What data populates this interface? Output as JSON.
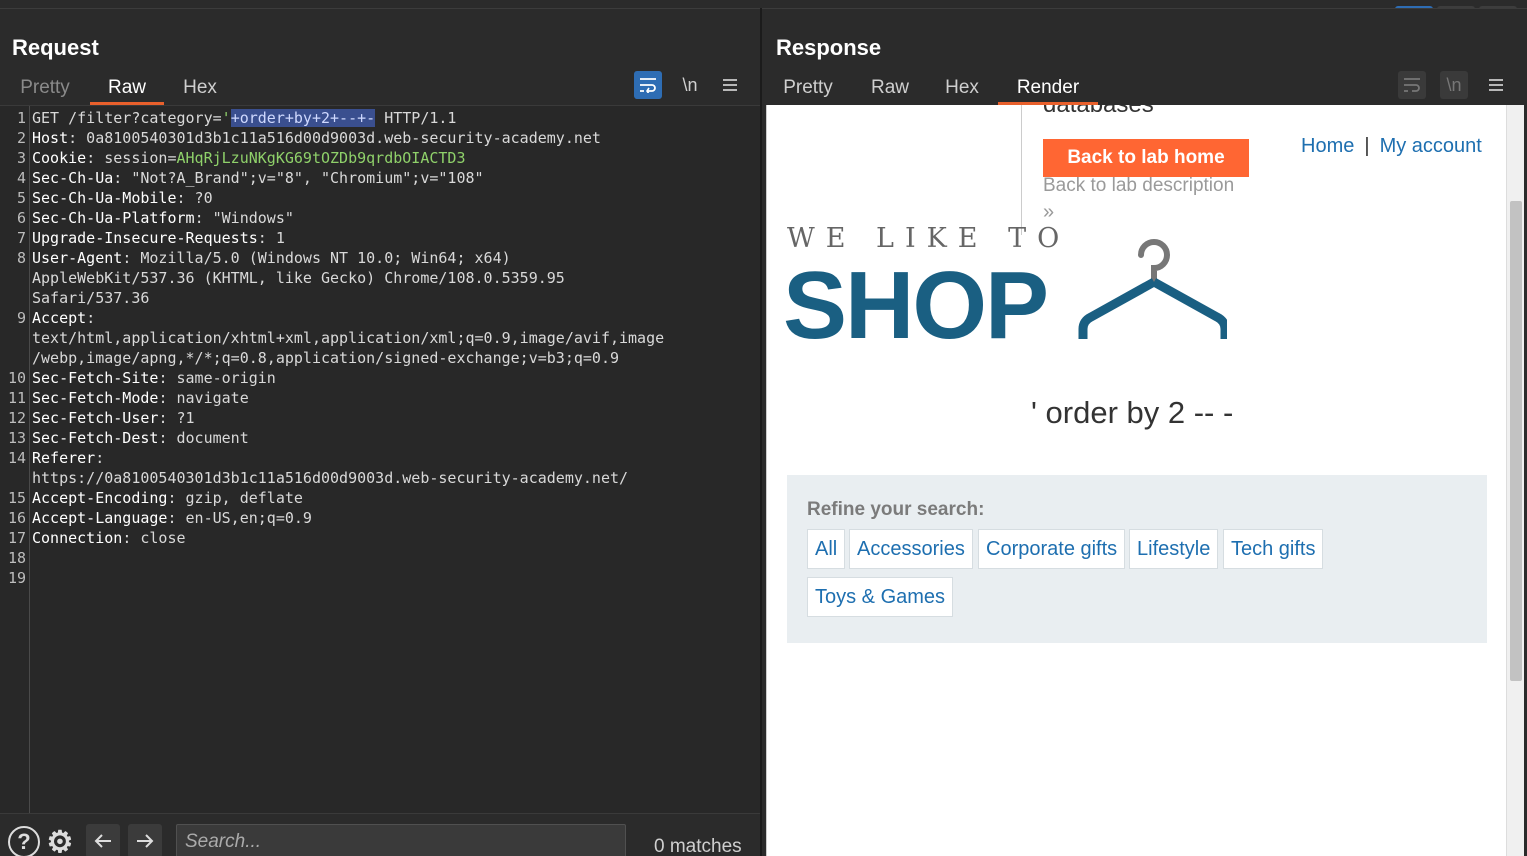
{
  "request": {
    "title": "Request",
    "tabs": [
      "Pretty",
      "Raw",
      "Hex"
    ],
    "active_tab": "Raw",
    "wrap_icon": "wrap-lines-icon",
    "newline_label": "\\n",
    "menu_icon": "hamburger-menu-icon",
    "lines": [
      {
        "n": "1",
        "parts": [
          [
            "v",
            "GET /filter?category="
          ],
          [
            "green",
            "'"
          ],
          [
            "sel",
            "+order+by+2+--+-"
          ],
          [
            "v",
            " HTTP/1.1"
          ]
        ]
      },
      {
        "n": "2",
        "parts": [
          [
            "k",
            "Host"
          ],
          [
            "v",
            ": 0a8100540301d3b1c11a516d00d9003d.web-security-academy.net"
          ]
        ]
      },
      {
        "n": "3",
        "parts": [
          [
            "k",
            "Cookie"
          ],
          [
            "v",
            ": session="
          ],
          [
            "green",
            "AHqRjLzuNKgKG69tOZDb9qrdbOIACTD3"
          ]
        ]
      },
      {
        "n": "4",
        "parts": [
          [
            "k",
            "Sec-Ch-Ua"
          ],
          [
            "v",
            ": \"Not?A_Brand\";v=\"8\", \"Chromium\";v=\"108\""
          ]
        ]
      },
      {
        "n": "5",
        "parts": [
          [
            "k",
            "Sec-Ch-Ua-Mobile"
          ],
          [
            "v",
            ": ?0"
          ]
        ]
      },
      {
        "n": "6",
        "parts": [
          [
            "k",
            "Sec-Ch-Ua-Platform"
          ],
          [
            "v",
            ": \"Windows\""
          ]
        ]
      },
      {
        "n": "7",
        "parts": [
          [
            "k",
            "Upgrade-Insecure-Requests"
          ],
          [
            "v",
            ": 1"
          ]
        ]
      },
      {
        "n": "8",
        "parts": [
          [
            "k",
            "User-Agent"
          ],
          [
            "v",
            ": Mozilla/5.0 (Windows NT 10.0; Win64; x64)"
          ]
        ]
      },
      {
        "n": "",
        "parts": [
          [
            "v",
            "AppleWebKit/537.36 (KHTML, like Gecko) Chrome/108.0.5359.95"
          ]
        ]
      },
      {
        "n": "",
        "parts": [
          [
            "v",
            "Safari/537.36"
          ]
        ]
      },
      {
        "n": "9",
        "parts": [
          [
            "k",
            "Accept"
          ],
          [
            "v",
            ":"
          ]
        ]
      },
      {
        "n": "",
        "parts": [
          [
            "v",
            "text/html,application/xhtml+xml,application/xml;q=0.9,image/avif,image"
          ]
        ]
      },
      {
        "n": "",
        "parts": [
          [
            "v",
            "/webp,image/apng,*/*;q=0.8,application/signed-exchange;v=b3;q=0.9"
          ]
        ]
      },
      {
        "n": "10",
        "parts": [
          [
            "k",
            "Sec-Fetch-Site"
          ],
          [
            "v",
            ": same-origin"
          ]
        ]
      },
      {
        "n": "11",
        "parts": [
          [
            "k",
            "Sec-Fetch-Mode"
          ],
          [
            "v",
            ": navigate"
          ]
        ]
      },
      {
        "n": "12",
        "parts": [
          [
            "k",
            "Sec-Fetch-User"
          ],
          [
            "v",
            ": ?1"
          ]
        ]
      },
      {
        "n": "13",
        "parts": [
          [
            "k",
            "Sec-Fetch-Dest"
          ],
          [
            "v",
            ": document"
          ]
        ]
      },
      {
        "n": "14",
        "parts": [
          [
            "k",
            "Referer"
          ],
          [
            "v",
            ":"
          ]
        ]
      },
      {
        "n": "",
        "parts": [
          [
            "v",
            "https://0a8100540301d3b1c11a516d00d9003d.web-security-academy.net/"
          ]
        ]
      },
      {
        "n": "15",
        "parts": [
          [
            "k",
            "Accept-Encoding"
          ],
          [
            "v",
            ": gzip, deflate"
          ]
        ]
      },
      {
        "n": "16",
        "parts": [
          [
            "k",
            "Accept-Language"
          ],
          [
            "v",
            ": en-US,en;q=0.9"
          ]
        ]
      },
      {
        "n": "17",
        "parts": [
          [
            "k",
            "Connection"
          ],
          [
            "v",
            ": close"
          ]
        ]
      },
      {
        "n": "18",
        "parts": []
      },
      {
        "n": "19",
        "parts": []
      }
    ],
    "search_placeholder": "Search...",
    "matches": "0 matches"
  },
  "response": {
    "title": "Response",
    "tabs": [
      "Pretty",
      "Raw",
      "Hex",
      "Render"
    ],
    "active_tab": "Render",
    "render": {
      "top_text": "databases",
      "back_to_lab_home": "Back to lab home",
      "back_to_lab_description": "Back to lab description",
      "chevron": "»",
      "nav_home": "Home",
      "nav_sep": "|",
      "nav_account": "My account",
      "logo_tagline": "WE LIKE TO",
      "logo_word": "SHOP",
      "search_term": "' order by 2 -- -",
      "refine_title": "Refine your search:",
      "categories": [
        "All",
        "Accessories",
        "Corporate gifts",
        "Lifestyle",
        "Tech gifts",
        "Toys & Games"
      ]
    }
  },
  "colors": {
    "accent_blue": "#2e6db4",
    "active_tab_underline": "#e8602c",
    "lab_button": "#ff6633",
    "shop_logo": "#1a5f82",
    "link": "#1e6fb0"
  }
}
